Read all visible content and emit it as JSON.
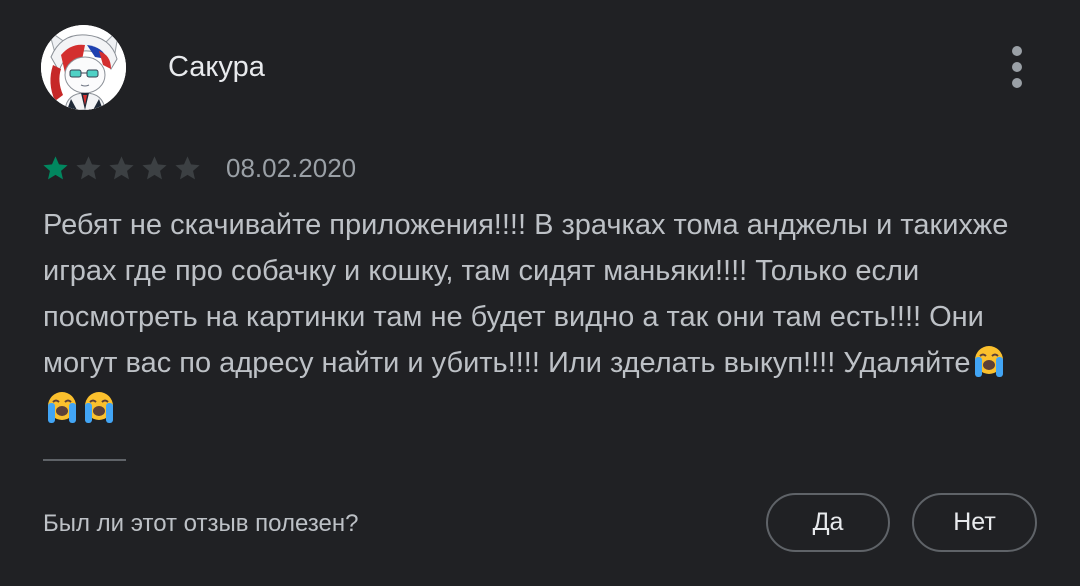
{
  "review": {
    "author": "Сакура",
    "rating": 1,
    "max_rating": 5,
    "date": "08.02.2020",
    "text": "Ребят не скачивайте приложения!!!! В зрачках тома анджелы и такихже играх где про собачку и кошку, там сидят маньяки!!!! Только если посмотреть на картинки там не будет видно а так они там есть!!!! Они могут вас по адресу найти и убить!!!! Или зделать выкуп!!!! Удаляйте",
    "emoji": [
      "loudly-crying-face",
      "loudly-crying-face",
      "loudly-crying-face"
    ]
  },
  "feedback": {
    "question": "Был ли этот отзыв полезен?",
    "yes_label": "Да",
    "no_label": "Нет"
  },
  "colors": {
    "background": "#202124",
    "star_filled": "#01875f",
    "star_empty": "#3c4043",
    "text_primary": "#e8eaed",
    "text_secondary": "#bdc1c6",
    "muted": "#9aa0a6",
    "outline": "#5f6368"
  },
  "icons": {
    "menu": "more-vert-icon",
    "star": "star-icon",
    "avatar": "anime-character-avatar"
  }
}
